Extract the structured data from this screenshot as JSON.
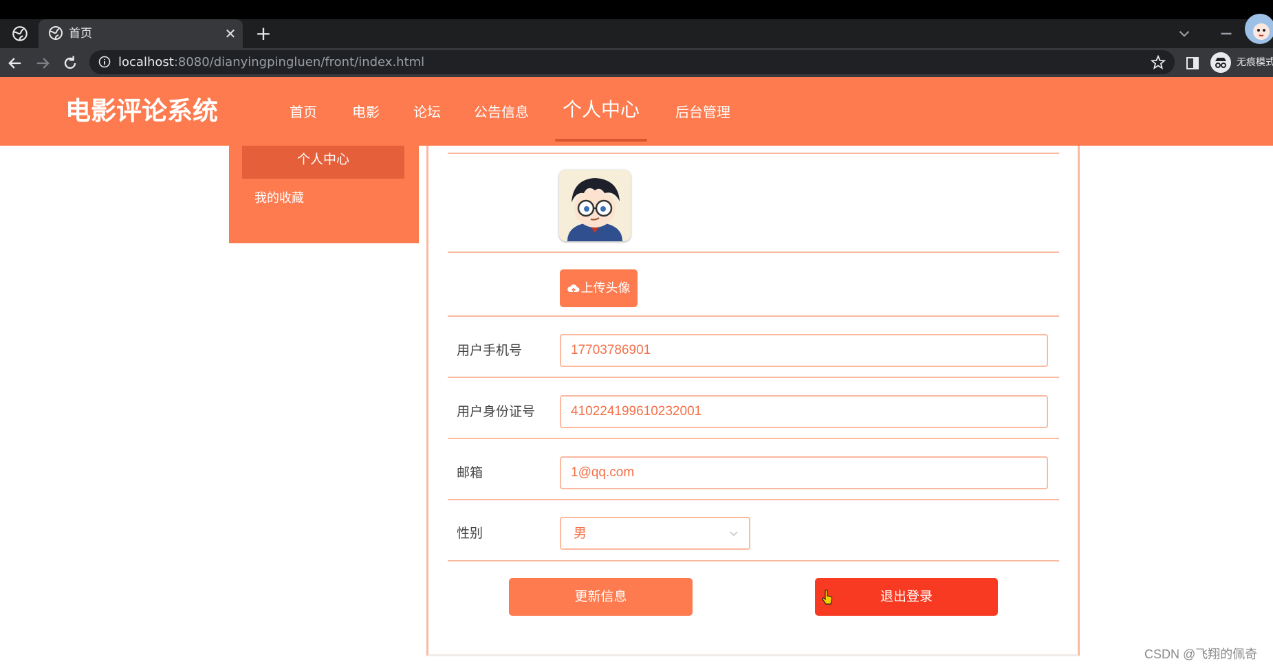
{
  "browser": {
    "tab": {
      "title": "首页"
    },
    "new_tab_symbol": "+",
    "close_symbol": "✕",
    "address": {
      "host": "localhost",
      "rest": ":8080/dianyingpingluen/front/index.html"
    },
    "incognito_label": "无痕模式"
  },
  "site": {
    "title": "电影评论系统",
    "nav": [
      "首页",
      "电影",
      "论坛",
      "公告信息",
      "个人中心",
      "后台管理"
    ],
    "active_nav": "个人中心",
    "accent_color": "#fd7b4f"
  },
  "sidebar": {
    "active_item": "个人中心",
    "items": [
      "我的收藏"
    ]
  },
  "form": {
    "upload_button": "上传头像",
    "phone": {
      "label": "用户手机号",
      "value": "17703786901"
    },
    "id_card": {
      "label": "用户身份证号",
      "value": "410224199610232001"
    },
    "email": {
      "label": "邮箱",
      "value": "1@qq.com"
    },
    "gender": {
      "label": "性别",
      "value": "男"
    },
    "update_button": "更新信息",
    "logout_button": "退出登录",
    "logout_color": "#f83a22"
  },
  "watermark": "CSDN @飞翔的佩奇"
}
